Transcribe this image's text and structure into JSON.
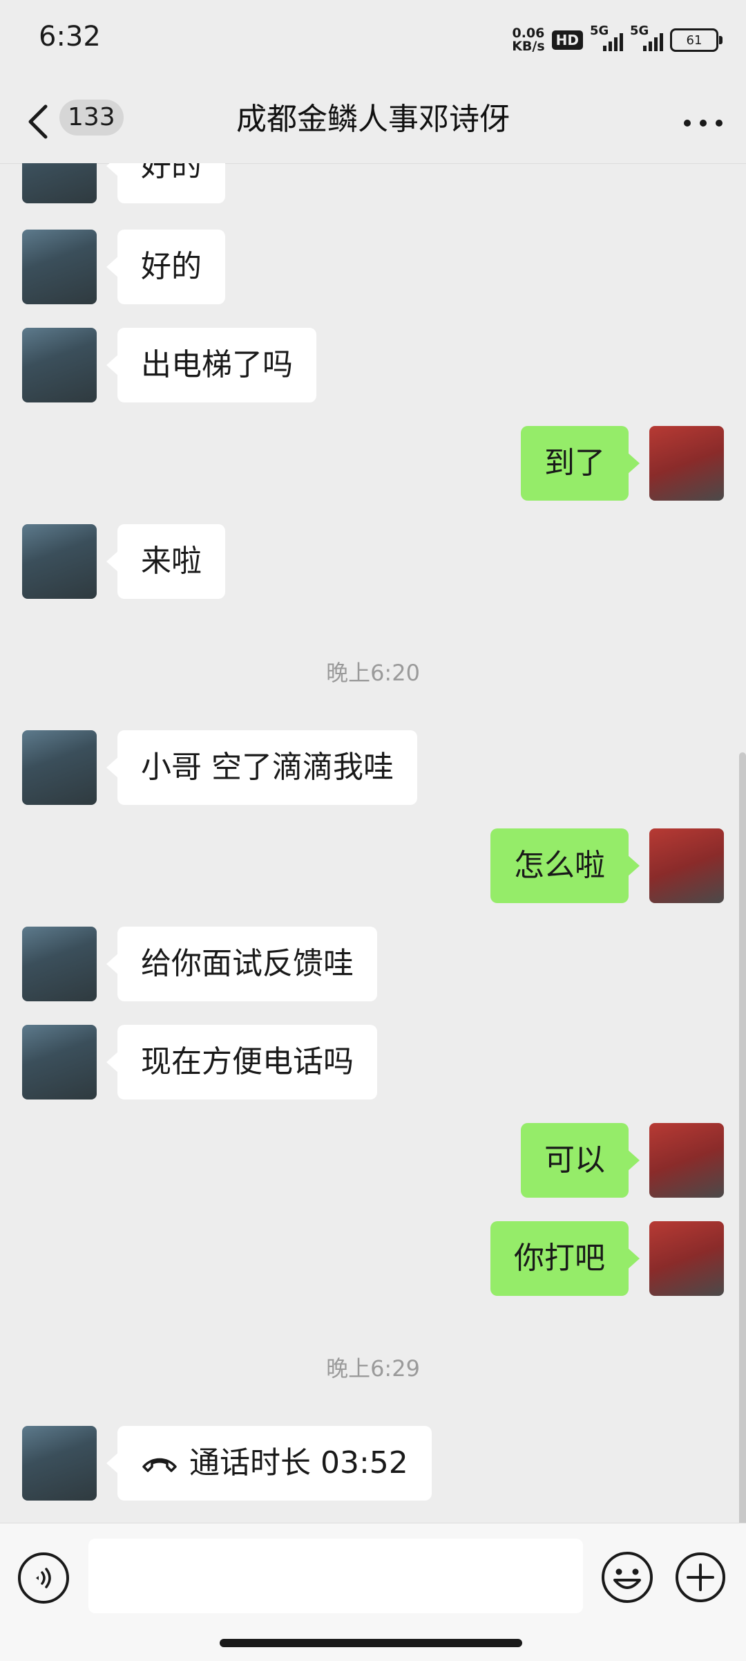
{
  "status_bar": {
    "time": "6:32",
    "net_speed_value": "0.06",
    "net_speed_unit": "KB/s",
    "hd_label": "HD",
    "sim1_label": "5G",
    "sim2_label": "5G",
    "battery": "61"
  },
  "header": {
    "unread_count": "133",
    "title": "成都金鳞人事邓诗伢"
  },
  "messages": [
    {
      "side": "left",
      "text": "好的"
    },
    {
      "side": "left",
      "text": "好的"
    },
    {
      "side": "left",
      "text": "出电梯了吗"
    },
    {
      "side": "right",
      "text": "到了"
    },
    {
      "side": "left",
      "text": "来啦"
    },
    {
      "timestamp": "晚上6:20"
    },
    {
      "side": "left",
      "text": "小哥 空了滴滴我哇"
    },
    {
      "side": "right",
      "text": "怎么啦"
    },
    {
      "side": "left",
      "text": "给你面试反馈哇"
    },
    {
      "side": "left",
      "text": "现在方便电话吗"
    },
    {
      "side": "right",
      "text": "可以"
    },
    {
      "side": "right",
      "text": "你打吧"
    },
    {
      "timestamp": "晚上6:29"
    },
    {
      "side": "left",
      "text": "通话时长 03:52",
      "icon": "phone-hangup-icon"
    }
  ],
  "input": {
    "placeholder": ""
  },
  "colors": {
    "background": "#ededed",
    "own_bubble": "#95ec69",
    "other_bubble": "#ffffff"
  }
}
